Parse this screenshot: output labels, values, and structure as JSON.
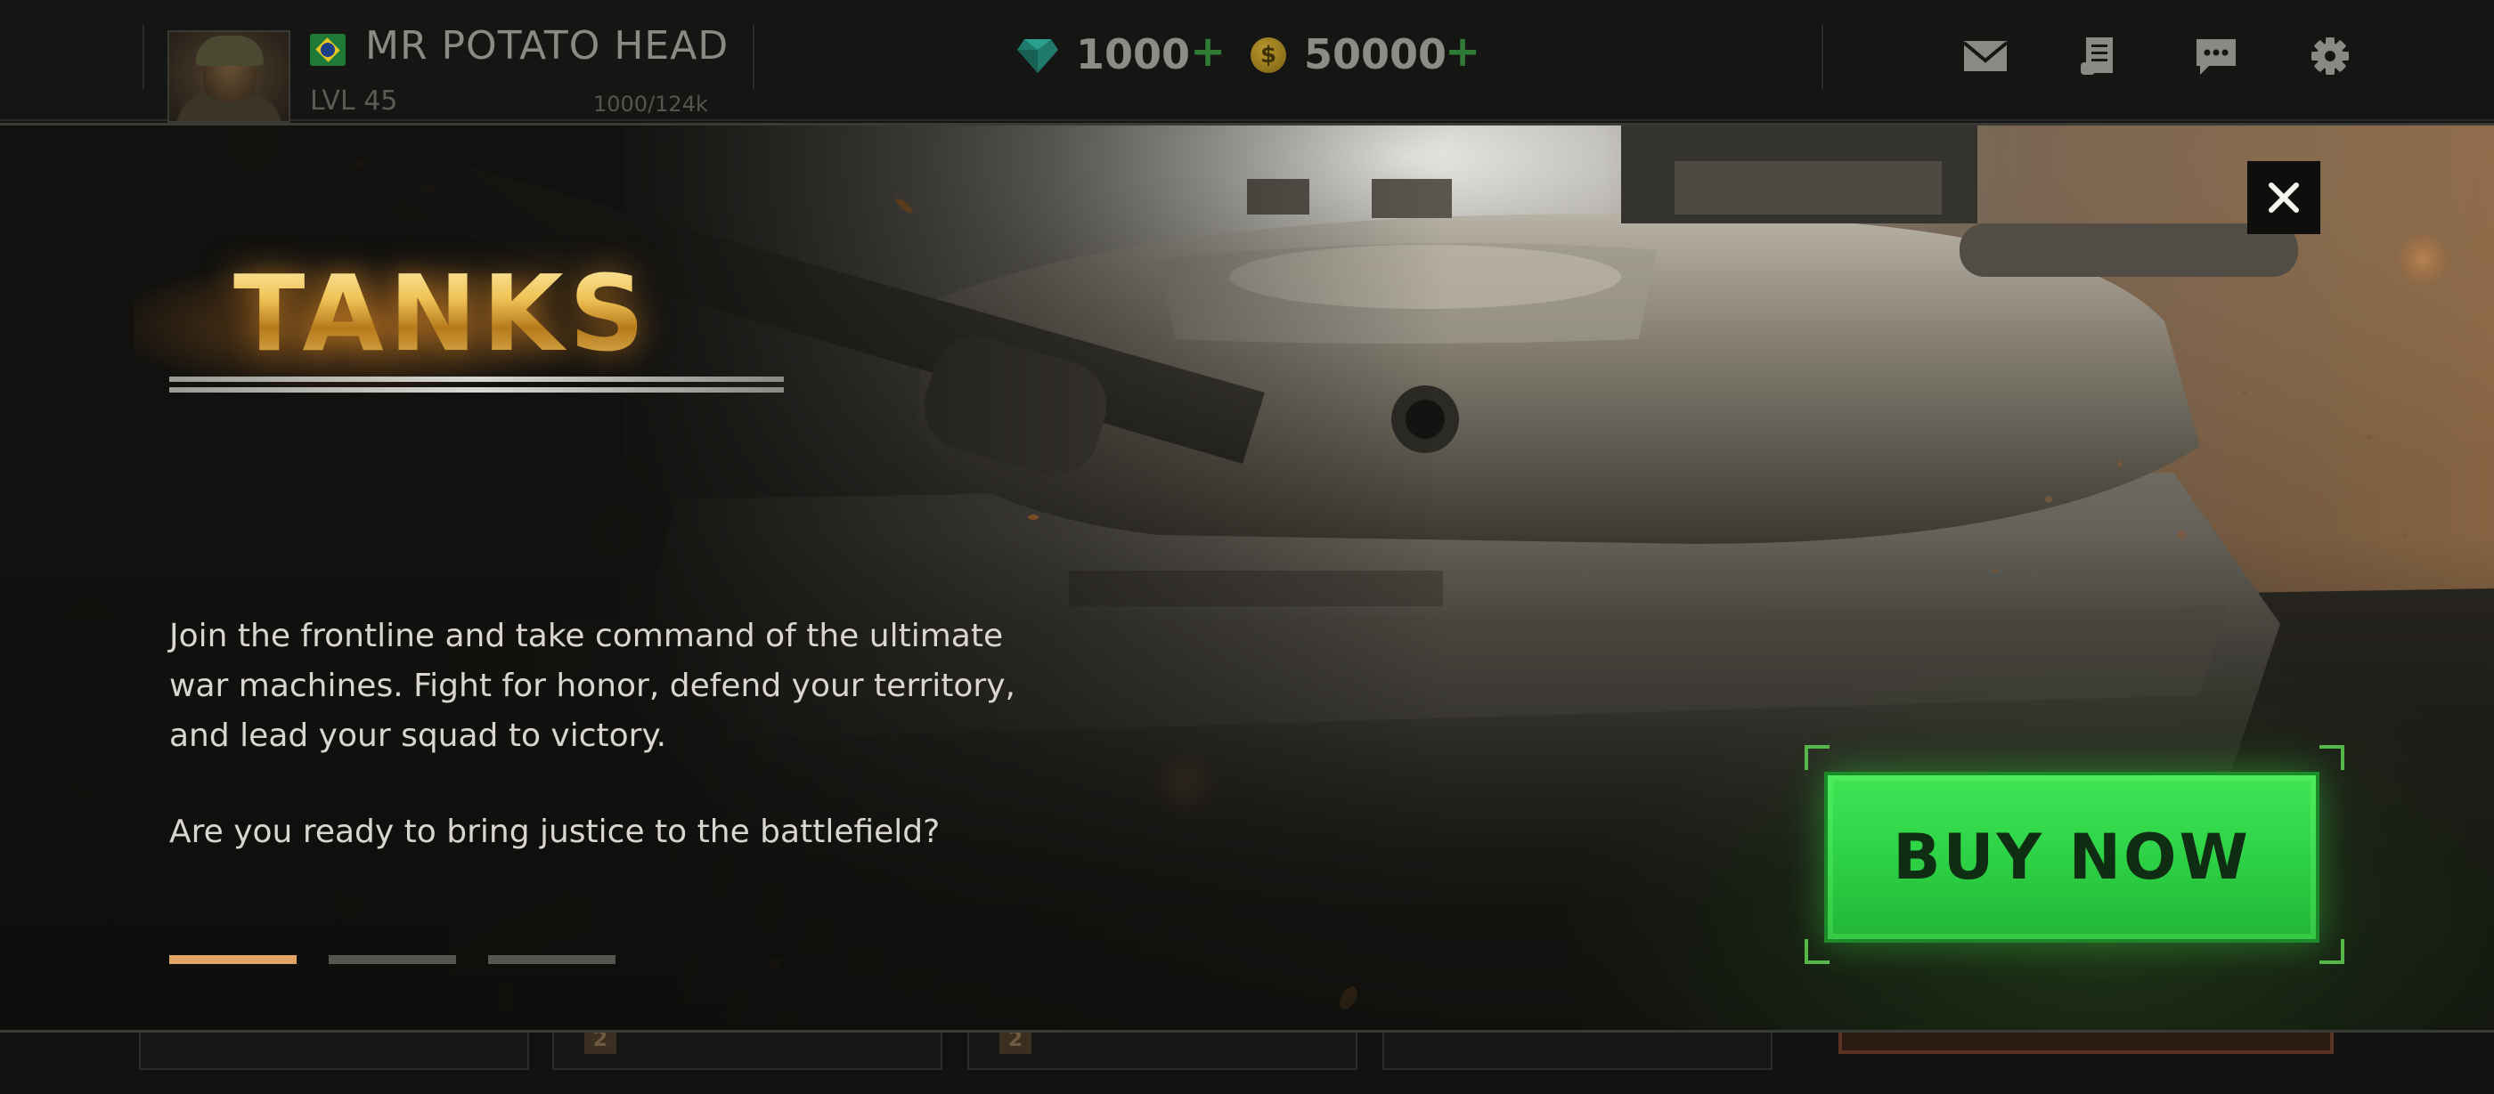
{
  "player": {
    "name": "MR POTATO HEAD",
    "level": "LVL 45",
    "xp": "1000/124k"
  },
  "currency": {
    "gems": "1000",
    "coins": "50000",
    "add_symbol": "+",
    "coin_symbol": "$"
  },
  "toolbar": {
    "icons": [
      "mail-icon",
      "scroll-icon",
      "chat-icon",
      "gear-icon"
    ]
  },
  "promo": {
    "title": "TANKS",
    "description": "Join the frontline and take command of the ultimate war machines. Fight for honor, defend your territory, and lead your squad to victory.",
    "question": "Are you ready to bring justice to the battlefield?",
    "buy_label": "BUY NOW",
    "close_symbol": "✕",
    "pagination": {
      "total": 3,
      "active": 1
    }
  },
  "bottom_cards": [
    "2",
    "2"
  ],
  "colors": {
    "accent_green": "#2ccf44",
    "title_gold": "#f0c356",
    "active_dot": "#e2a366",
    "inactive_dot": "#55554f",
    "background": "#141412"
  }
}
